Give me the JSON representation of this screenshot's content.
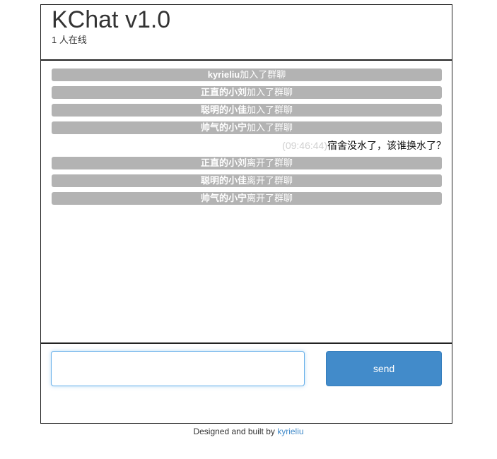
{
  "header": {
    "title": "KChat v1.0",
    "online_status": "1 人在线"
  },
  "messages": [
    {
      "type": "system",
      "name": "kyrieliu",
      "action": "加入了群聊"
    },
    {
      "type": "system",
      "name": "正直的小刘",
      "action": "加入了群聊"
    },
    {
      "type": "system",
      "name": "聪明的小佳",
      "action": "加入了群聊"
    },
    {
      "type": "system",
      "name": "帅气的小宁",
      "action": "加入了群聊"
    },
    {
      "type": "chat",
      "time": "(09:46:44)",
      "text": "宿舍没水了，该谁换水了？"
    },
    {
      "type": "system",
      "name": "正直的小刘",
      "action": "离开了群聊"
    },
    {
      "type": "system",
      "name": "聪明的小佳",
      "action": "离开了群聊"
    },
    {
      "type": "system",
      "name": "帅气的小宁",
      "action": "离开了群聊"
    }
  ],
  "composer": {
    "input_value": "",
    "send_label": "send"
  },
  "footer": {
    "text": "Designed and built by ",
    "author_link": "kyrieliu"
  },
  "colors": {
    "system_bg": "#b3b3b3",
    "accent": "#428bca",
    "border": "#222222"
  }
}
